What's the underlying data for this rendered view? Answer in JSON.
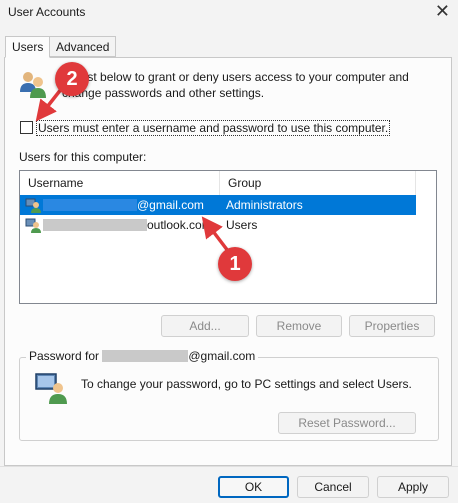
{
  "window": {
    "title": "User Accounts",
    "close_glyph": "✕"
  },
  "tabs": [
    {
      "label": "Users",
      "selected": true
    },
    {
      "label": "Advanced",
      "selected": false
    }
  ],
  "users_tab": {
    "description": "the list below to grant or deny users access to your computer and change passwords and other settings.",
    "checkbox_label": "Users must enter a username and password to use this computer.",
    "checkbox_checked": false,
    "list_label": "Users for this computer:",
    "columns": [
      "Username",
      "Group"
    ],
    "rows": [
      {
        "username_suffix": "@gmail.com",
        "group": "Administrators",
        "selected": true
      },
      {
        "username_suffix": "outlook.com",
        "group": "Users",
        "selected": false
      }
    ],
    "buttons": {
      "add": "Add...",
      "remove": "Remove",
      "properties": "Properties"
    },
    "password_group": {
      "label_prefix": "Password for",
      "label_suffix": "@gmail.com",
      "text": "To change your password, go to PC settings and select Users.",
      "reset_button": "Reset Password..."
    }
  },
  "footer": {
    "ok": "OK",
    "cancel": "Cancel",
    "apply": "Apply"
  },
  "annotations": {
    "marker1": "1",
    "marker2": "2",
    "color": "#e0393b"
  },
  "colors": {
    "selection": "#0078d7",
    "default_button_border": "#0067c0"
  }
}
